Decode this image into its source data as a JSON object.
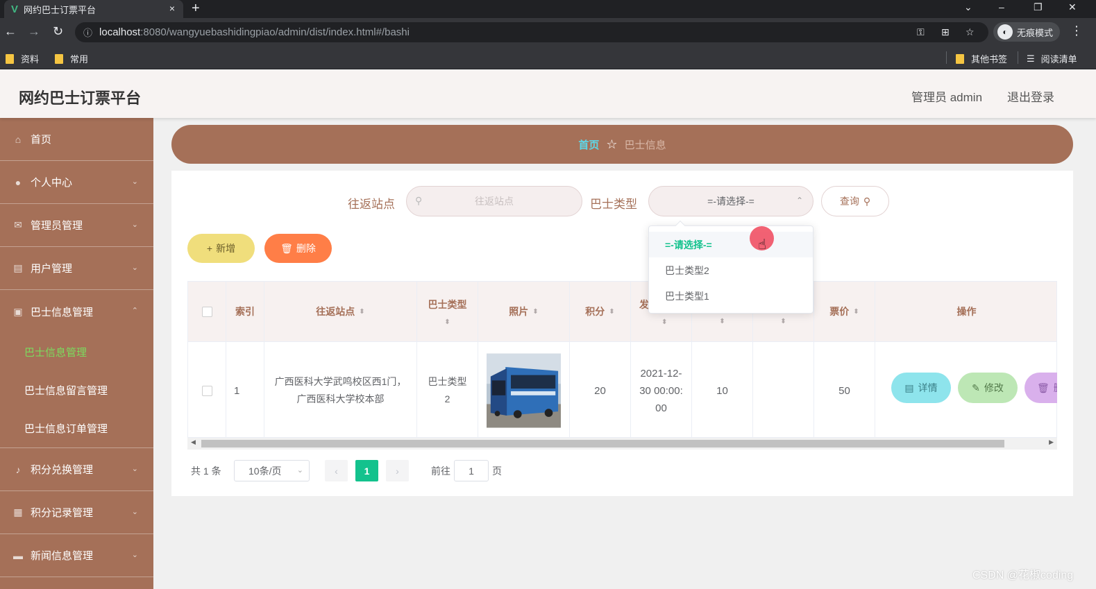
{
  "browser": {
    "tab_title": "网约巴士订票平台",
    "tab_close": "×",
    "new_tab": "+",
    "url_host": "localhost",
    "url_path": ":8080/wangyuebashidingpiao/admin/dist/index.html#/bashi",
    "incognito_label": "无痕模式",
    "bookmarks": [
      "资料",
      "常用"
    ],
    "other_bookmarks": "其他书签",
    "reading_list": "阅读清单"
  },
  "header": {
    "title": "网约巴士订票平台",
    "admin_label": "管理员 admin",
    "logout": "退出登录"
  },
  "sidebar": {
    "items": [
      {
        "label": "首页",
        "icon": "home-icon"
      },
      {
        "label": "个人中心",
        "icon": "user-icon"
      },
      {
        "label": "管理员管理",
        "icon": "mail-icon"
      },
      {
        "label": "用户管理",
        "icon": "doc-icon"
      },
      {
        "label": "巴士信息管理",
        "icon": "picture-icon"
      },
      {
        "label": "积分兑换管理",
        "icon": "mic-icon"
      },
      {
        "label": "积分记录管理",
        "icon": "grid-icon"
      },
      {
        "label": "新闻信息管理",
        "icon": "news-icon"
      }
    ],
    "submenu": [
      {
        "label": "巴士信息管理",
        "active": true
      },
      {
        "label": "巴士信息留言管理",
        "active": false
      },
      {
        "label": "巴士信息订单管理",
        "active": false
      }
    ]
  },
  "breadcrumb": {
    "home": "首页",
    "current": "巴士信息"
  },
  "search": {
    "station_label": "往返站点",
    "station_placeholder": "往返站点",
    "type_label": "巴士类型",
    "type_value": "=-请选择-=",
    "query_button": "查询"
  },
  "actions": {
    "add": "新增",
    "delete": "删除"
  },
  "table": {
    "columns": [
      "索引",
      "往返站点",
      "巴士类型",
      "照片",
      "积分",
      "发",
      "票价",
      "操作"
    ],
    "rows": [
      {
        "index": "1",
        "station": "广西医科大学武鸣校区西1门，广西医科大学校本部",
        "bus_type": "巴士类型2",
        "points": "20",
        "depart": "2021-12-30 00:00:00",
        "col_seats": "10",
        "price": "50",
        "ops": [
          "详情",
          "修改",
          "删"
        ]
      }
    ]
  },
  "pagination": {
    "total": "共 1 条",
    "page_size": "10条/页",
    "current": "1",
    "goto_label": "前往",
    "goto_value": "1",
    "page_label": "页"
  },
  "dropdown": {
    "options": [
      "=-请选择-=",
      "巴士类型2",
      "巴士类型1"
    ],
    "selected": "=-请选择-="
  },
  "watermark": "CSDN @花椒coding",
  "colors": {
    "sidebar": "#a57058",
    "accent_green": "#13c28d",
    "breadcrumb_home": "#5dd8e9",
    "add_button": "#f0de7c",
    "delete_button": "#ff7e47",
    "detail_button": "#8ee4ec",
    "edit_button": "#bde7b5",
    "remove_button": "#d9b0ec"
  }
}
